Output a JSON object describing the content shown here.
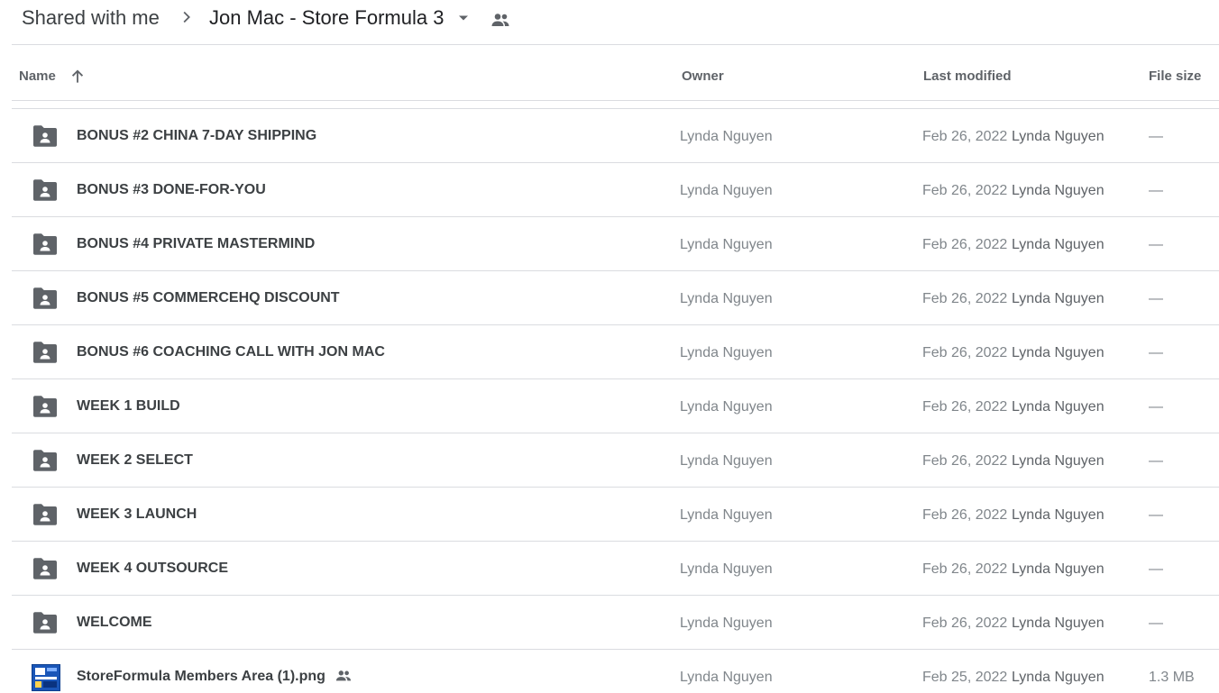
{
  "breadcrumb": {
    "root": "Shared with me",
    "current": "Jon Mac - Store Formula 3",
    "separator_icon": "chevron-right-icon",
    "dropdown_icon": "caret-down-icon",
    "shared_icon": "people-icon"
  },
  "columns": {
    "name": "Name",
    "owner": "Owner",
    "last_modified": "Last modified",
    "file_size": "File size",
    "sort_icon": "arrow-up-icon"
  },
  "rows": [
    {
      "name": "BONUS #2 CHINA 7-DAY SHIPPING",
      "type": "shared-folder",
      "owner": "Lynda Nguyen",
      "date": "Feb 26, 2022",
      "modifier": "Lynda Nguyen",
      "size": "—"
    },
    {
      "name": "BONUS #3 DONE-FOR-YOU",
      "type": "shared-folder",
      "owner": "Lynda Nguyen",
      "date": "Feb 26, 2022",
      "modifier": "Lynda Nguyen",
      "size": "—"
    },
    {
      "name": "BONUS #4 PRIVATE MASTERMIND",
      "type": "shared-folder",
      "owner": "Lynda Nguyen",
      "date": "Feb 26, 2022",
      "modifier": "Lynda Nguyen",
      "size": "—"
    },
    {
      "name": "BONUS #5 COMMERCEHQ DISCOUNT",
      "type": "shared-folder",
      "owner": "Lynda Nguyen",
      "date": "Feb 26, 2022",
      "modifier": "Lynda Nguyen",
      "size": "—"
    },
    {
      "name": "BONUS #6 COACHING CALL WITH JON MAC",
      "type": "shared-folder",
      "owner": "Lynda Nguyen",
      "date": "Feb 26, 2022",
      "modifier": "Lynda Nguyen",
      "size": "—"
    },
    {
      "name": "WEEK 1 BUILD",
      "type": "shared-folder",
      "owner": "Lynda Nguyen",
      "date": "Feb 26, 2022",
      "modifier": "Lynda Nguyen",
      "size": "—"
    },
    {
      "name": "WEEK 2 SELECT",
      "type": "shared-folder",
      "owner": "Lynda Nguyen",
      "date": "Feb 26, 2022",
      "modifier": "Lynda Nguyen",
      "size": "—"
    },
    {
      "name": "WEEK 3 LAUNCH",
      "type": "shared-folder",
      "owner": "Lynda Nguyen",
      "date": "Feb 26, 2022",
      "modifier": "Lynda Nguyen",
      "size": "—"
    },
    {
      "name": "WEEK 4 OUTSOURCE",
      "type": "shared-folder",
      "owner": "Lynda Nguyen",
      "date": "Feb 26, 2022",
      "modifier": "Lynda Nguyen",
      "size": "—"
    },
    {
      "name": "WELCOME",
      "type": "shared-folder",
      "owner": "Lynda Nguyen",
      "date": "Feb 26, 2022",
      "modifier": "Lynda Nguyen",
      "size": "—"
    },
    {
      "name": "StoreFormula Members Area (1).png",
      "type": "image-file",
      "shared": true,
      "owner": "Lynda Nguyen",
      "date": "Feb 25, 2022",
      "modifier": "Lynda Nguyen",
      "size": "1.3 MB"
    }
  ],
  "colors": {
    "icon_gray": "#5f6368",
    "divider": "#dadce0",
    "text_primary": "#3c4043",
    "text_secondary": "#80868b",
    "thumb_blue": "#1a56b8"
  }
}
